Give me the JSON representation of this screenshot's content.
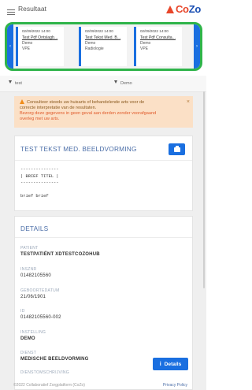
{
  "header": {
    "title": "Resultaat",
    "logo": {
      "part1": "Co",
      "part2": "Zo"
    }
  },
  "carousel": {
    "cards": [
      {
        "date": "02/09/2022 14:00",
        "name": "Test Pdf Ontslagb...",
        "dept": "Demo",
        "type": "VPE"
      },
      {
        "date": "02/09/2022 14:00",
        "name": "Test Tekst Med. B...",
        "dept": "Demo",
        "type": "Radiologie"
      },
      {
        "date": "02/09/2022 14:00",
        "name": "Test Pdf Consulta...",
        "dept": "Demo",
        "type": "VPE"
      }
    ],
    "prev_label": "‹",
    "next_label": "›"
  },
  "filters": {
    "left": "test",
    "right": "Demo"
  },
  "warning": {
    "line1": "Consulteer steeds uw huisarts of behandelende arts voor de",
    "line2": "correcte interpretatie van de resultaten.",
    "line3": "Bezorg deze gegevens in geen geval aan derden zonder voorafgaand",
    "line4": "overleg met uw arts.",
    "close": "×"
  },
  "document": {
    "title": "TEST TEKST MED. BEELDVORMING",
    "body": "---------------\n| BRIEF TITEL |\n---------------\n\nbrief brief"
  },
  "details": {
    "title": "DETAILS",
    "fields": [
      {
        "label": "PATIENT",
        "value": "TESTPATIËNT XDTESTCOZOHUB"
      },
      {
        "label": "INSZNR",
        "value": "01482105560"
      },
      {
        "label": "GEBOORTEDATUM",
        "value": "21/06/1901"
      },
      {
        "label": "ID",
        "value": "01482105560-002"
      },
      {
        "label": "INSTELLING",
        "value": "DEMO"
      },
      {
        "label": "DIENST",
        "value": "MEDISCHE BEELDVORMING"
      },
      {
        "label": "DIENSTOMSCHRIJVING",
        "value": ""
      }
    ],
    "button_label": "Details",
    "button_icon": "i"
  },
  "footer": {
    "copyright": "©2022 Collaboratief Zorgplatform (CoZo)",
    "privacy": "Privacy Policy"
  },
  "colors": {
    "accent": "#1a6fe0",
    "highlight": "#2fb44a",
    "warning_bg": "#fbe0c6",
    "brand_red": "#e8462a"
  }
}
